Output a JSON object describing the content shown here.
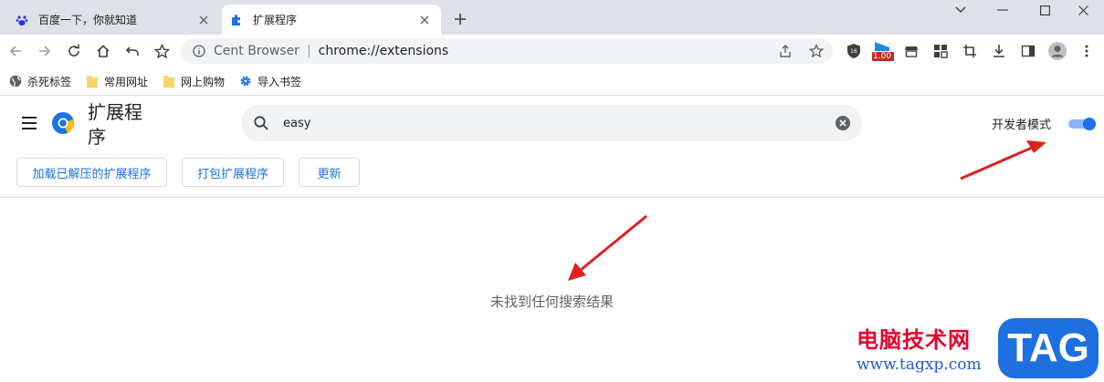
{
  "tabs": [
    {
      "title": "百度一下，你就知道",
      "icon": "baidu-paw-icon",
      "active": false
    },
    {
      "title": "扩展程序",
      "icon": "puzzle-icon",
      "active": true
    }
  ],
  "omnibox": {
    "brand": "Cent Browser",
    "separator": "|",
    "url": "chrome://extensions"
  },
  "extension_badge": "1.00",
  "bookmarks": [
    {
      "label": "杀死标签",
      "icon": "globe-icon"
    },
    {
      "label": "常用网址",
      "icon": "folder-icon"
    },
    {
      "label": "网上购物",
      "icon": "folder-icon"
    },
    {
      "label": "导入书签",
      "icon": "gear-icon"
    }
  ],
  "page": {
    "title": "扩展程序",
    "search_value": "easy",
    "developer_mode_label": "开发者模式",
    "developer_mode_on": true,
    "buttons": [
      "加载已解压的扩展程序",
      "打包扩展程序",
      "更新"
    ],
    "empty_message": "未找到任何搜索结果"
  },
  "watermark": {
    "text": "电脑技术网",
    "url": "www.tagxp.com",
    "tag": "TAG"
  },
  "colors": {
    "accent": "#1a73e8",
    "arrow": "#e02020",
    "titlebar": "#dee1e6"
  }
}
